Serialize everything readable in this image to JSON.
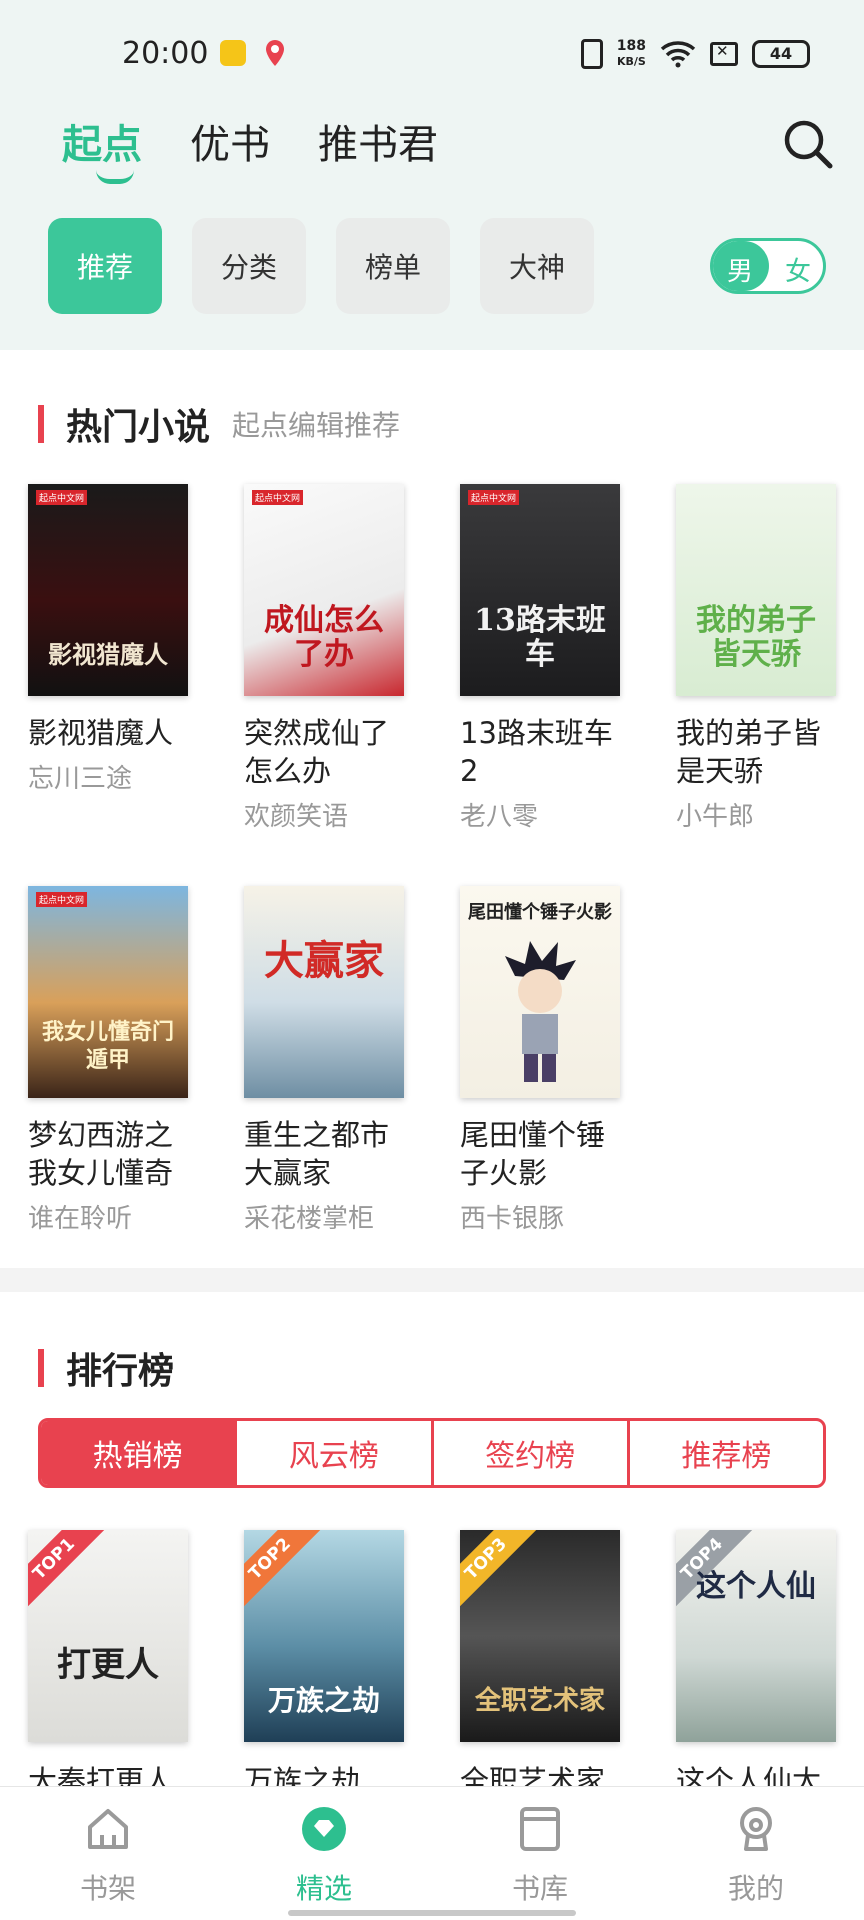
{
  "status_bar": {
    "time": "20:00",
    "net_speed_value": "188",
    "net_speed_unit": "KB/S",
    "battery": "44"
  },
  "primary_tabs": [
    {
      "label": "起点",
      "active": true
    },
    {
      "label": "优书",
      "active": false
    },
    {
      "label": "推书君",
      "active": false
    }
  ],
  "search_icon": "search-icon",
  "sub_tabs": [
    {
      "label": "推荐",
      "active": true
    },
    {
      "label": "分类",
      "active": false
    },
    {
      "label": "榜单",
      "active": false
    },
    {
      "label": "大神",
      "active": false
    }
  ],
  "gender_toggle": {
    "male": "男",
    "female": "女",
    "selected": "男"
  },
  "hot_novels": {
    "title": "热门小说",
    "subtitle": "起点编辑推荐",
    "books": [
      {
        "title": "影视猎魔人",
        "author": "忘川三途",
        "cover_text": "影视猎魔人"
      },
      {
        "title": "突然成仙了怎么办",
        "author": "欢颜笑语",
        "cover_text": "成仙怎么了办"
      },
      {
        "title": "13路末班车2",
        "author": "老八零",
        "cover_text": "13路末班车"
      },
      {
        "title": "我的弟子皆是天骄",
        "author": "小牛郎",
        "cover_text": "我的弟子皆天骄"
      },
      {
        "title": "梦幻西游之我女儿懂奇",
        "author": "谁在聆听",
        "cover_text": "我女儿懂奇门遁甲"
      },
      {
        "title": "重生之都市大赢家",
        "author": "采花楼掌柜",
        "cover_text": "大赢家"
      },
      {
        "title": "尾田懂个锤子火影",
        "author": "西卡银豚",
        "cover_text": "尾田懂个锤子火影"
      }
    ]
  },
  "ranking": {
    "title": "排行榜",
    "tabs": [
      {
        "label": "热销榜",
        "active": true
      },
      {
        "label": "风云榜",
        "active": false
      },
      {
        "label": "签约榜",
        "active": false
      },
      {
        "label": "推荐榜",
        "active": false
      }
    ],
    "books": [
      {
        "rank": "TOP1",
        "title": "大秦打更人",
        "cover_text": "打更人",
        "badge_color": "#e8424f"
      },
      {
        "rank": "TOP2",
        "title": "万族之劫",
        "cover_text": "万族之劫",
        "badge_color": "#f0763a"
      },
      {
        "rank": "TOP3",
        "title": "全职艺术家",
        "cover_text": "全职艺术家",
        "badge_color": "#f2b629"
      },
      {
        "rank": "TOP4",
        "title": "这个人仙太",
        "cover_text": "这个人仙",
        "badge_color": "#9aa0a6"
      }
    ]
  },
  "bottom_nav": [
    {
      "label": "书架",
      "icon": "bookshelf-icon",
      "active": false
    },
    {
      "label": "精选",
      "icon": "featured-icon",
      "active": true
    },
    {
      "label": "书库",
      "icon": "library-icon",
      "active": false
    },
    {
      "label": "我的",
      "icon": "profile-icon",
      "active": false
    }
  ],
  "colors": {
    "accent_green": "#2dbf8f",
    "accent_red": "#e8424f",
    "header_bg": "#eef5f3"
  }
}
